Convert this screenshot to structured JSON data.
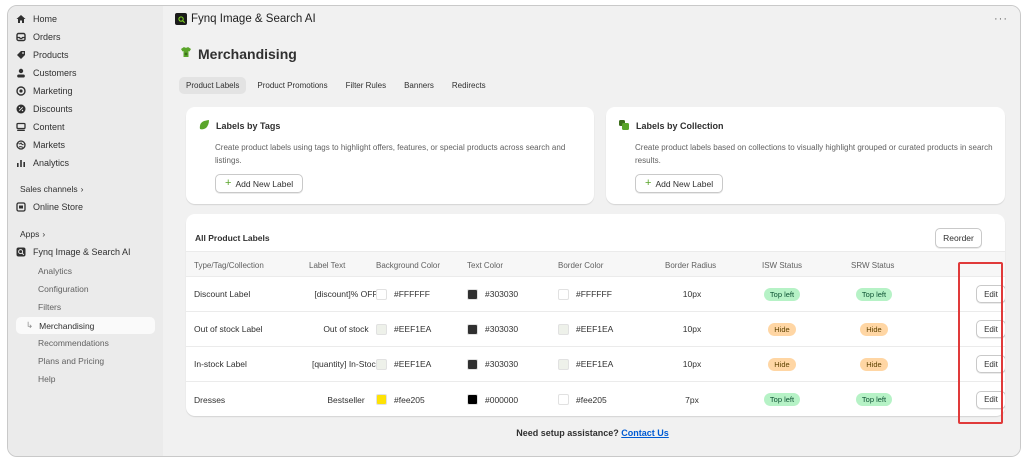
{
  "sidebar": {
    "items": [
      {
        "label": "Home",
        "icon": "home-icon"
      },
      {
        "label": "Orders",
        "icon": "inbox-icon"
      },
      {
        "label": "Products",
        "icon": "tag-icon"
      },
      {
        "label": "Customers",
        "icon": "person-icon"
      },
      {
        "label": "Marketing",
        "icon": "target-icon"
      },
      {
        "label": "Discounts",
        "icon": "discount-icon"
      },
      {
        "label": "Content",
        "icon": "content-icon"
      },
      {
        "label": "Markets",
        "icon": "globe-icon"
      },
      {
        "label": "Analytics",
        "icon": "bar-chart-icon"
      }
    ],
    "sales_channels_label": "Sales channels",
    "online_store_label": "Online Store",
    "apps_label": "Apps",
    "app_name": "Fynq Image & Search AI",
    "app_subitems": [
      "Analytics",
      "Configuration",
      "Filters"
    ],
    "active_subitem": "Merchandising",
    "app_subitems_after": [
      "Recommendations",
      "Plans and Pricing",
      "Help"
    ]
  },
  "header": {
    "app_title": "Fynq Image & Search AI",
    "more_label": "···"
  },
  "page": {
    "title": "Merchandising",
    "tabs": [
      "Product Labels",
      "Product Promotions",
      "Filter Rules",
      "Banners",
      "Redirects"
    ],
    "active_tab": "Product Labels"
  },
  "cards": [
    {
      "title": "Labels by Tags",
      "description": "Create product labels using tags to highlight offers, features, or special products across search and listings.",
      "button_label": "Add New Label"
    },
    {
      "title": "Labels by Collection",
      "description": "Create product labels based on collections to visually highlight grouped or curated products in search results.",
      "button_label": "Add New Label"
    }
  ],
  "table": {
    "title": "All Product Labels",
    "reorder_label": "Reorder",
    "columns": [
      "Type/Tag/Collection",
      "Label Text",
      "Background Color",
      "Text Color",
      "Border Color",
      "Border Radius",
      "ISW Status",
      "SRW Status"
    ],
    "edit_label": "Edit",
    "rows": [
      {
        "type": "Discount Label",
        "label_text": "[discount]% OFF",
        "bg": "#FFFFFF",
        "bg_swatch": "#ffffff",
        "text_color": "#303030",
        "text_swatch": "#303030",
        "border": "#FFFFFF",
        "border_swatch": "#ffffff",
        "radius": "10px",
        "isw": "Top left",
        "isw_tone": "green",
        "srw": "Top left",
        "srw_tone": "green"
      },
      {
        "type": "Out of stock Label",
        "label_text": "Out of stock",
        "bg": "#EEF1EA",
        "bg_swatch": "#eef1ea",
        "text_color": "#303030",
        "text_swatch": "#303030",
        "border": "#EEF1EA",
        "border_swatch": "#eef1ea",
        "radius": "10px",
        "isw": "Hide",
        "isw_tone": "orange",
        "srw": "Hide",
        "srw_tone": "orange"
      },
      {
        "type": "In-stock Label",
        "label_text": "[quantity] In-Stock",
        "bg": "#EEF1EA",
        "bg_swatch": "#eef1ea",
        "text_color": "#303030",
        "text_swatch": "#303030",
        "border": "#EEF1EA",
        "border_swatch": "#eef1ea",
        "radius": "10px",
        "isw": "Hide",
        "isw_tone": "orange",
        "srw": "Hide",
        "srw_tone": "orange"
      },
      {
        "type": "Dresses",
        "label_text": "Bestseller",
        "bg": "#fee205",
        "bg_swatch": "#fee205",
        "text_color": "#000000",
        "text_swatch": "#000000",
        "border": "#fee205",
        "border_swatch": "#ffffff",
        "radius": "7px",
        "isw": "Top left",
        "isw_tone": "green",
        "srw": "Top left",
        "srw_tone": "green"
      }
    ]
  },
  "footer": {
    "prompt": "Need setup assistance?",
    "link": "Contact Us"
  },
  "colors": {
    "highlight": "#e03a3a",
    "link": "#005bd3",
    "accent_green": "#5aa52a"
  }
}
